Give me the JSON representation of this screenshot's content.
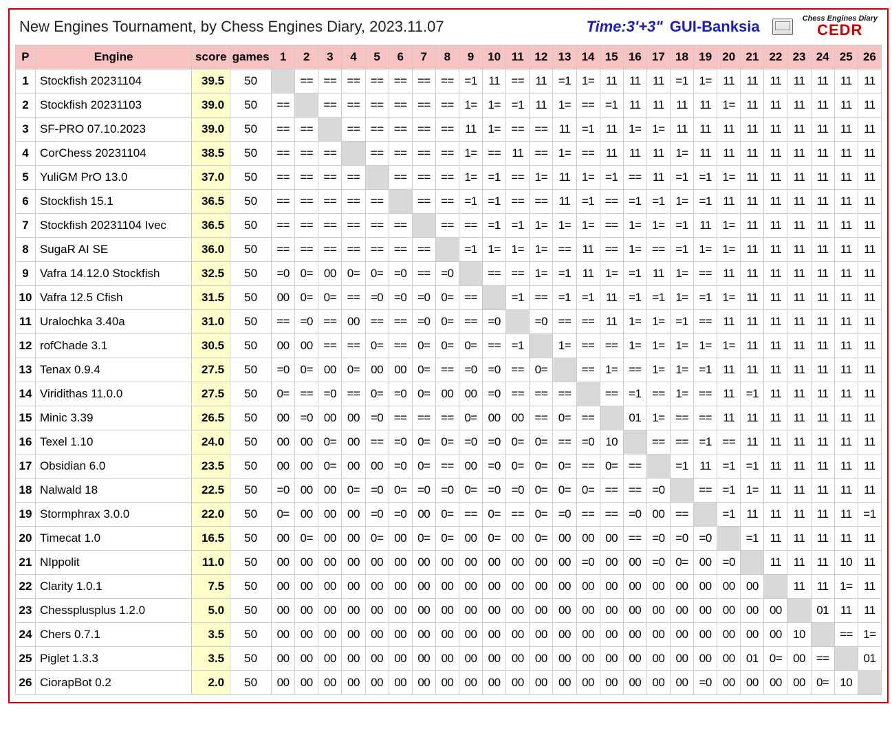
{
  "header": {
    "title": "New Engines Tournament, by Chess Engines Diary, 2023.11.07",
    "time_label": "Time:3'+3\"",
    "gui_label": "GUI-Banksia",
    "brand_top": "Chess Engines Diary",
    "brand_main": "CEDR"
  },
  "columns": {
    "pos": "P",
    "engine": "Engine",
    "score": "score",
    "games": "games",
    "rounds": [
      "1",
      "2",
      "3",
      "4",
      "5",
      "6",
      "7",
      "8",
      "9",
      "10",
      "11",
      "12",
      "13",
      "14",
      "15",
      "16",
      "17",
      "18",
      "19",
      "20",
      "21",
      "22",
      "23",
      "24",
      "25",
      "26"
    ]
  },
  "rows": [
    {
      "p": "1",
      "e": "Stockfish 20231104",
      "s": "39.5",
      "g": "50",
      "r": [
        "",
        "==",
        "==",
        "==",
        "==",
        "==",
        "==",
        "==",
        "=1",
        "11",
        "==",
        "11",
        "=1",
        "1=",
        "11",
        "11",
        "11",
        "=1",
        "1=",
        "11",
        "11",
        "11",
        "11",
        "11",
        "11",
        "11"
      ]
    },
    {
      "p": "2",
      "e": "Stockfish 20231103",
      "s": "39.0",
      "g": "50",
      "r": [
        "==",
        "",
        "==",
        "==",
        "==",
        "==",
        "==",
        "==",
        "1=",
        "1=",
        "=1",
        "11",
        "1=",
        "==",
        "=1",
        "11",
        "11",
        "11",
        "11",
        "1=",
        "11",
        "11",
        "11",
        "11",
        "11",
        "11"
      ]
    },
    {
      "p": "3",
      "e": "SF-PRO 07.10.2023",
      "s": "39.0",
      "g": "50",
      "r": [
        "==",
        "==",
        "",
        "==",
        "==",
        "==",
        "==",
        "==",
        "11",
        "1=",
        "==",
        "==",
        "11",
        "=1",
        "11",
        "1=",
        "1=",
        "11",
        "11",
        "11",
        "11",
        "11",
        "11",
        "11",
        "11",
        "11"
      ]
    },
    {
      "p": "4",
      "e": "CorChess 20231104",
      "s": "38.5",
      "g": "50",
      "r": [
        "==",
        "==",
        "==",
        "",
        "==",
        "==",
        "==",
        "==",
        "1=",
        "==",
        "11",
        "==",
        "1=",
        "==",
        "11",
        "11",
        "11",
        "1=",
        "11",
        "11",
        "11",
        "11",
        "11",
        "11",
        "11",
        "11"
      ]
    },
    {
      "p": "5",
      "e": "YuliGM PrO 13.0",
      "s": "37.0",
      "g": "50",
      "r": [
        "==",
        "==",
        "==",
        "==",
        "",
        "==",
        "==",
        "==",
        "1=",
        "=1",
        "==",
        "1=",
        "11",
        "1=",
        "=1",
        "==",
        "11",
        "=1",
        "=1",
        "1=",
        "11",
        "11",
        "11",
        "11",
        "11",
        "11"
      ]
    },
    {
      "p": "6",
      "e": "Stockfish 15.1",
      "s": "36.5",
      "g": "50",
      "r": [
        "==",
        "==",
        "==",
        "==",
        "==",
        "",
        "==",
        "==",
        "=1",
        "=1",
        "==",
        "==",
        "11",
        "=1",
        "==",
        "=1",
        "=1",
        "1=",
        "=1",
        "11",
        "11",
        "11",
        "11",
        "11",
        "11",
        "11"
      ]
    },
    {
      "p": "7",
      "e": "Stockfish 20231104 Ivec",
      "s": "36.5",
      "g": "50",
      "r": [
        "==",
        "==",
        "==",
        "==",
        "==",
        "==",
        "",
        "==",
        "==",
        "=1",
        "=1",
        "1=",
        "1=",
        "1=",
        "==",
        "1=",
        "1=",
        "=1",
        "11",
        "1=",
        "11",
        "11",
        "11",
        "11",
        "11",
        "11"
      ]
    },
    {
      "p": "8",
      "e": "SugaR AI SE",
      "s": "36.0",
      "g": "50",
      "r": [
        "==",
        "==",
        "==",
        "==",
        "==",
        "==",
        "==",
        "",
        "=1",
        "1=",
        "1=",
        "1=",
        "==",
        "11",
        "==",
        "1=",
        "==",
        "=1",
        "1=",
        "1=",
        "11",
        "11",
        "11",
        "11",
        "11",
        "11"
      ]
    },
    {
      "p": "9",
      "e": "Vafra 14.12.0 Stockfish",
      "s": "32.5",
      "g": "50",
      "r": [
        "=0",
        "0=",
        "00",
        "0=",
        "0=",
        "=0",
        "==",
        "=0",
        "",
        "==",
        "==",
        "1=",
        "=1",
        "11",
        "1=",
        "=1",
        "11",
        "1=",
        "==",
        "11",
        "11",
        "11",
        "11",
        "11",
        "11",
        "11"
      ]
    },
    {
      "p": "10",
      "e": "Vafra 12.5 Cfish",
      "s": "31.5",
      "g": "50",
      "r": [
        "00",
        "0=",
        "0=",
        "==",
        "=0",
        "=0",
        "=0",
        "0=",
        "==",
        "",
        "=1",
        "==",
        "=1",
        "=1",
        "11",
        "=1",
        "=1",
        "1=",
        "=1",
        "1=",
        "11",
        "11",
        "11",
        "11",
        "11",
        "11"
      ]
    },
    {
      "p": "11",
      "e": "Uralochka 3.40a",
      "s": "31.0",
      "g": "50",
      "r": [
        "==",
        "=0",
        "==",
        "00",
        "==",
        "==",
        "=0",
        "0=",
        "==",
        "=0",
        "",
        "=0",
        "==",
        "==",
        "11",
        "1=",
        "1=",
        "=1",
        "==",
        "11",
        "11",
        "11",
        "11",
        "11",
        "11",
        "11"
      ]
    },
    {
      "p": "12",
      "e": "rofChade 3.1",
      "s": "30.5",
      "g": "50",
      "r": [
        "00",
        "00",
        "==",
        "==",
        "0=",
        "==",
        "0=",
        "0=",
        "0=",
        "==",
        "=1",
        "",
        "1=",
        "==",
        "==",
        "1=",
        "1=",
        "1=",
        "1=",
        "1=",
        "11",
        "11",
        "11",
        "11",
        "11",
        "11"
      ]
    },
    {
      "p": "13",
      "e": "Tenax 0.9.4",
      "s": "27.5",
      "g": "50",
      "r": [
        "=0",
        "0=",
        "00",
        "0=",
        "00",
        "00",
        "0=",
        "==",
        "=0",
        "=0",
        "==",
        "0=",
        "",
        "==",
        "1=",
        "==",
        "1=",
        "1=",
        "=1",
        "11",
        "11",
        "11",
        "11",
        "11",
        "11",
        "11"
      ]
    },
    {
      "p": "14",
      "e": "Viridithas 11.0.0",
      "s": "27.5",
      "g": "50",
      "r": [
        "0=",
        "==",
        "=0",
        "==",
        "0=",
        "=0",
        "0=",
        "00",
        "00",
        "=0",
        "==",
        "==",
        "==",
        "",
        "==",
        "=1",
        "==",
        "1=",
        "==",
        "11",
        "=1",
        "11",
        "11",
        "11",
        "11",
        "11"
      ]
    },
    {
      "p": "15",
      "e": "Minic 3.39",
      "s": "26.5",
      "g": "50",
      "r": [
        "00",
        "=0",
        "00",
        "00",
        "=0",
        "==",
        "==",
        "==",
        "0=",
        "00",
        "00",
        "==",
        "0=",
        "==",
        "",
        "01",
        "1=",
        "==",
        "==",
        "11",
        "11",
        "11",
        "11",
        "11",
        "11",
        "11"
      ]
    },
    {
      "p": "16",
      "e": "Texel 1.10",
      "s": "24.0",
      "g": "50",
      "r": [
        "00",
        "00",
        "0=",
        "00",
        "==",
        "=0",
        "0=",
        "0=",
        "=0",
        "=0",
        "0=",
        "0=",
        "==",
        "=0",
        "10",
        "",
        "==",
        "==",
        "=1",
        "==",
        "11",
        "11",
        "11",
        "11",
        "11",
        "11"
      ]
    },
    {
      "p": "17",
      "e": "Obsidian 6.0",
      "s": "23.5",
      "g": "50",
      "r": [
        "00",
        "00",
        "0=",
        "00",
        "00",
        "=0",
        "0=",
        "==",
        "00",
        "=0",
        "0=",
        "0=",
        "0=",
        "==",
        "0=",
        "==",
        "",
        "=1",
        "11",
        "=1",
        "=1",
        "11",
        "11",
        "11",
        "11",
        "11"
      ]
    },
    {
      "p": "18",
      "e": "Nalwald 18",
      "s": "22.5",
      "g": "50",
      "r": [
        "=0",
        "00",
        "00",
        "0=",
        "=0",
        "0=",
        "=0",
        "=0",
        "0=",
        "=0",
        "=0",
        "0=",
        "0=",
        "0=",
        "==",
        "==",
        "=0",
        "",
        "==",
        "=1",
        "1=",
        "11",
        "11",
        "11",
        "11",
        "11"
      ]
    },
    {
      "p": "19",
      "e": "Stormphrax 3.0.0",
      "s": "22.0",
      "g": "50",
      "r": [
        "0=",
        "00",
        "00",
        "00",
        "=0",
        "=0",
        "00",
        "0=",
        "==",
        "0=",
        "==",
        "0=",
        "=0",
        "==",
        "==",
        "=0",
        "00",
        "==",
        "",
        "=1",
        "11",
        "11",
        "11",
        "11",
        "11",
        "=1"
      ]
    },
    {
      "p": "20",
      "e": "Timecat 1.0",
      "s": "16.5",
      "g": "50",
      "r": [
        "00",
        "0=",
        "00",
        "00",
        "0=",
        "00",
        "0=",
        "0=",
        "00",
        "0=",
        "00",
        "0=",
        "00",
        "00",
        "00",
        "==",
        "=0",
        "=0",
        "=0",
        "",
        "=1",
        "11",
        "11",
        "11",
        "11",
        "11"
      ]
    },
    {
      "p": "21",
      "e": "NIppolit",
      "s": "11.0",
      "g": "50",
      "r": [
        "00",
        "00",
        "00",
        "00",
        "00",
        "00",
        "00",
        "00",
        "00",
        "00",
        "00",
        "00",
        "00",
        "=0",
        "00",
        "00",
        "=0",
        "0=",
        "00",
        "=0",
        "",
        "11",
        "11",
        "11",
        "10",
        "11"
      ]
    },
    {
      "p": "22",
      "e": "Clarity 1.0.1",
      "s": "7.5",
      "g": "50",
      "r": [
        "00",
        "00",
        "00",
        "00",
        "00",
        "00",
        "00",
        "00",
        "00",
        "00",
        "00",
        "00",
        "00",
        "00",
        "00",
        "00",
        "00",
        "00",
        "00",
        "00",
        "00",
        "",
        "11",
        "11",
        "1=",
        "11"
      ]
    },
    {
      "p": "23",
      "e": "Chessplusplus 1.2.0",
      "s": "5.0",
      "g": "50",
      "r": [
        "00",
        "00",
        "00",
        "00",
        "00",
        "00",
        "00",
        "00",
        "00",
        "00",
        "00",
        "00",
        "00",
        "00",
        "00",
        "00",
        "00",
        "00",
        "00",
        "00",
        "00",
        "00",
        "",
        "01",
        "11",
        "11"
      ]
    },
    {
      "p": "24",
      "e": "Chers 0.7.1",
      "s": "3.5",
      "g": "50",
      "r": [
        "00",
        "00",
        "00",
        "00",
        "00",
        "00",
        "00",
        "00",
        "00",
        "00",
        "00",
        "00",
        "00",
        "00",
        "00",
        "00",
        "00",
        "00",
        "00",
        "00",
        "00",
        "00",
        "10",
        "",
        "==",
        "1="
      ]
    },
    {
      "p": "25",
      "e": "Piglet 1.3.3",
      "s": "3.5",
      "g": "50",
      "r": [
        "00",
        "00",
        "00",
        "00",
        "00",
        "00",
        "00",
        "00",
        "00",
        "00",
        "00",
        "00",
        "00",
        "00",
        "00",
        "00",
        "00",
        "00",
        "00",
        "00",
        "01",
        "0=",
        "00",
        "==",
        "",
        "01"
      ]
    },
    {
      "p": "26",
      "e": "CiorapBot 0.2",
      "s": "2.0",
      "g": "50",
      "r": [
        "00",
        "00",
        "00",
        "00",
        "00",
        "00",
        "00",
        "00",
        "00",
        "00",
        "00",
        "00",
        "00",
        "00",
        "00",
        "00",
        "00",
        "00",
        "=0",
        "00",
        "00",
        "00",
        "00",
        "0=",
        "10",
        ""
      ]
    }
  ]
}
